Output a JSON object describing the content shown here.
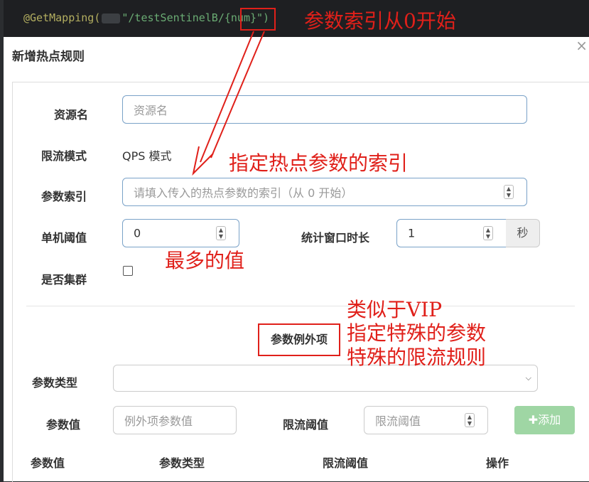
{
  "code": {
    "annotation": "@GetMapping(",
    "path_prefix": "\"/testSentinelB/",
    "path_param": "{num}",
    "path_suffix": "\")"
  },
  "annotations": {
    "param_index_start": "参数索引从0开始",
    "hot_param_index": "指定热点参数的索引",
    "max_value": "最多的值",
    "like_vip": "类似于VIP",
    "special_param": "指定特殊的参数",
    "special_rule": "特殊的限流规则"
  },
  "modal": {
    "title": "新增热点规则",
    "close": "×",
    "resource": {
      "label": "资源名",
      "placeholder": "资源名"
    },
    "flow_mode": {
      "label": "限流模式",
      "value": "QPS 模式"
    },
    "param_index": {
      "label": "参数索引",
      "placeholder": "请填入传入的热点参数的索引（从 0 开始）"
    },
    "threshold": {
      "label": "单机阈值",
      "value": "0"
    },
    "window": {
      "label": "统计窗口时长",
      "value": "1",
      "unit": "秒"
    },
    "cluster": {
      "label": "是否集群"
    },
    "exception_section": "参数例外项",
    "param_type": {
      "label": "参数类型",
      "value": ""
    },
    "param_value": {
      "label": "参数值",
      "placeholder": "例外项参数值"
    },
    "limit_threshold": {
      "label": "限流阈值",
      "placeholder": "限流阈值"
    },
    "add_button": "添加",
    "table_headers": [
      "参数值",
      "参数类型",
      "限流阈值",
      "操作"
    ]
  },
  "colors": {
    "annotation_red": "#e0201a",
    "add_button": "#9fd6a4",
    "input_border": "#7aa2c8"
  }
}
